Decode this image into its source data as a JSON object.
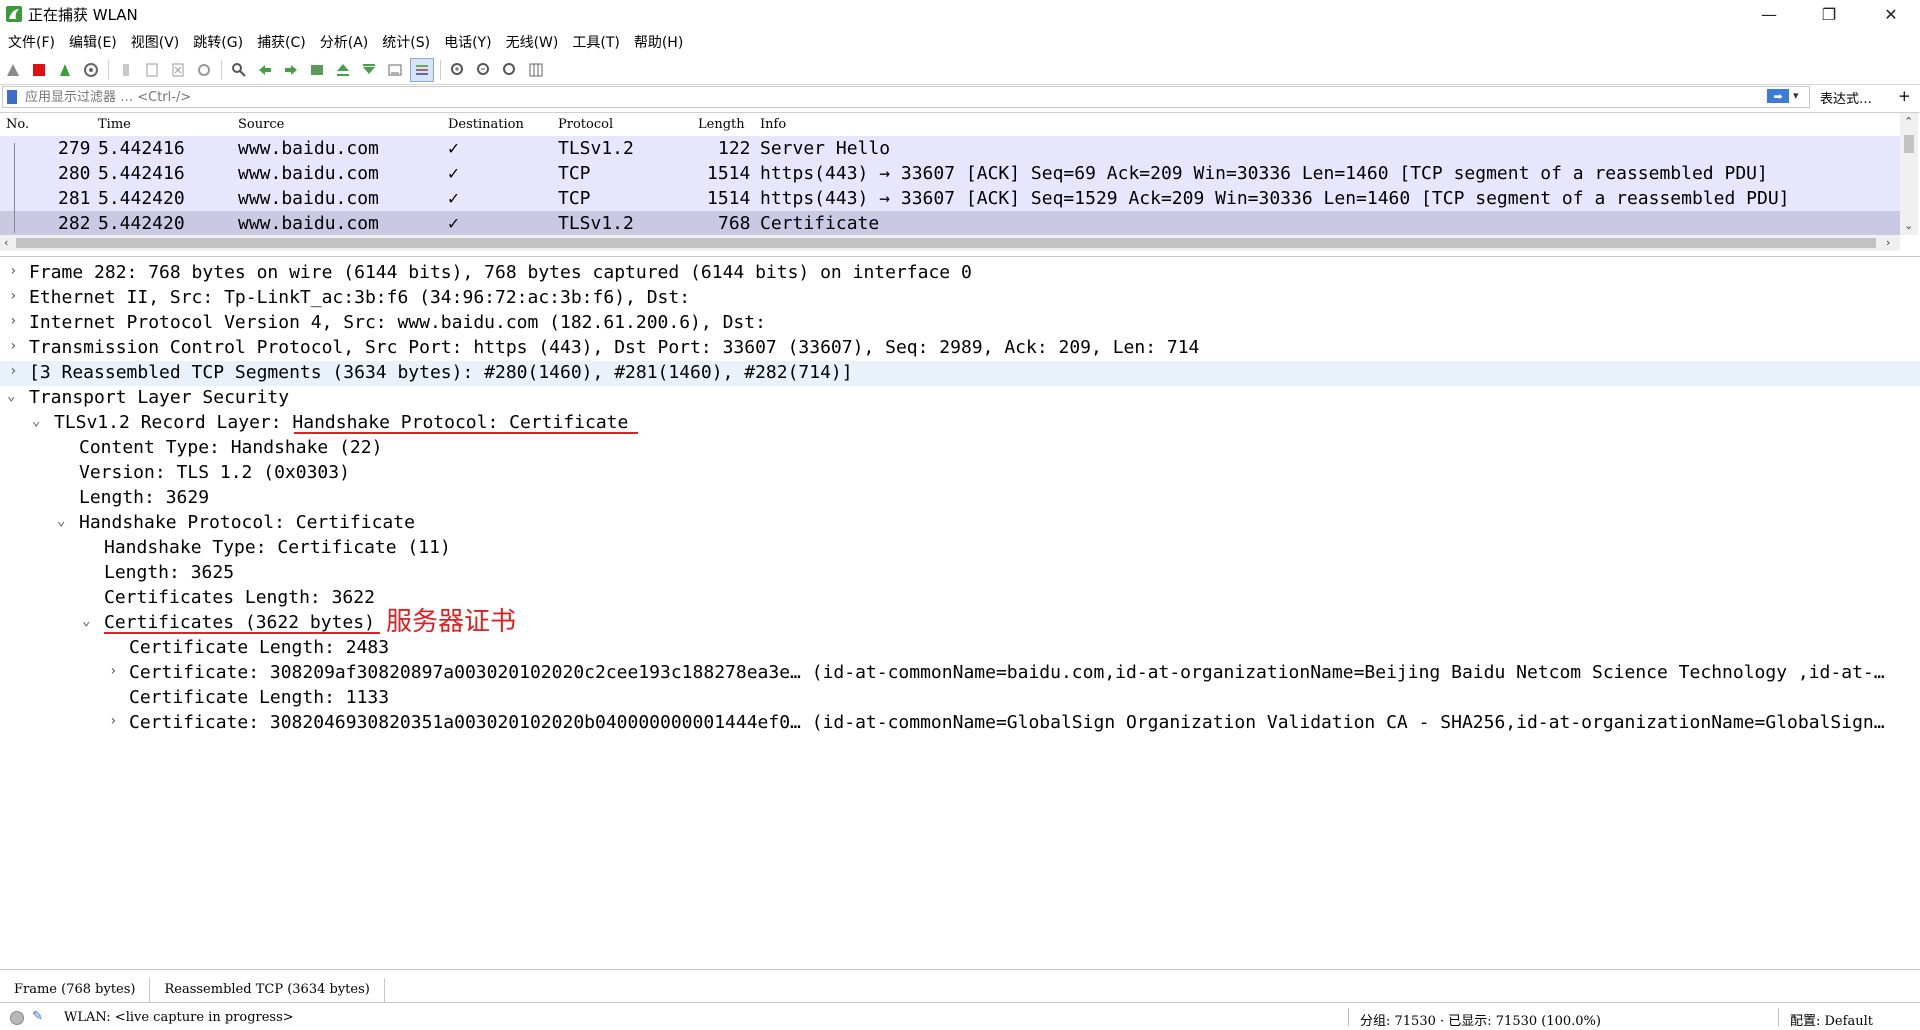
{
  "window": {
    "title": "正在捕获 WLAN",
    "controls": {
      "minimize": "—",
      "maximize": "❐",
      "close": "✕"
    }
  },
  "menu": [
    "文件(F)",
    "编辑(E)",
    "视图(V)",
    "跳转(G)",
    "捕获(C)",
    "分析(A)",
    "统计(S)",
    "电话(Y)",
    "无线(W)",
    "工具(T)",
    "帮助(H)"
  ],
  "filter": {
    "placeholder": "应用显示过滤器 … <Ctrl-/>",
    "apply_icon": "➡",
    "dropdown": "▾",
    "expression_button": "表达式…",
    "add_button": "+"
  },
  "packet_list": {
    "columns": [
      "No.",
      "Time",
      "Source",
      "Destination",
      "Protocol",
      "Length",
      "Info"
    ],
    "rows": [
      {
        "no": "279",
        "time": "5.442416",
        "source": "www.baidu.com",
        "destination": "✓",
        "protocol": "TLSv1.2",
        "length": "122",
        "info": "Server Hello"
      },
      {
        "no": "280",
        "time": "5.442416",
        "source": "www.baidu.com",
        "destination": "✓",
        "protocol": "TCP",
        "length": "1514",
        "info": "https(443) → 33607 [ACK] Seq=69 Ack=209 Win=30336 Len=1460 [TCP segment of a reassembled PDU]"
      },
      {
        "no": "281",
        "time": "5.442420",
        "source": "www.baidu.com",
        "destination": "✓",
        "protocol": "TCP",
        "length": "1514",
        "info": "https(443) → 33607 [ACK] Seq=1529 Ack=209 Win=30336 Len=1460 [TCP segment of a reassembled PDU]"
      },
      {
        "no": "282",
        "time": "5.442420",
        "source": "www.baidu.com",
        "destination": "✓",
        "protocol": "TLSv1.2",
        "length": "768",
        "info": "Certificate"
      }
    ]
  },
  "details": {
    "lines": [
      "Frame 282: 768 bytes on wire (6144 bits), 768 bytes captured (6144 bits) on interface 0",
      "Ethernet II, Src: Tp-LinkT_ac:3b:f6 (34:96:72:ac:3b:f6), Dst:",
      "Internet Protocol Version 4, Src: www.baidu.com (182.61.200.6), Dst:",
      "Transmission Control Protocol, Src Port: https (443), Dst Port: 33607 (33607), Seq: 2989, Ack: 209, Len: 714",
      "[3 Reassembled TCP Segments (3634 bytes): #280(1460), #281(1460), #282(714)]",
      "Transport Layer Security",
      "TLSv1.2 Record Layer: Handshake Protocol: Certificate",
      "Content Type: Handshake (22)",
      "Version: TLS 1.2 (0x0303)",
      "Length: 3629",
      "Handshake Protocol: Certificate",
      "Handshake Type: Certificate (11)",
      "Length: 3625",
      "Certificates Length: 3622",
      "Certificates (3622 bytes)",
      "Certificate Length: 2483",
      "Certificate: 308209af30820897a003020102020c2cee193c188278ea3e… (id-at-commonName=baidu.com,id-at-organizationName=Beijing Baidu Netcom Science Technology ,id-at-…",
      "Certificate Length: 1133",
      "Certificate: 3082046930820351a003020102020b040000000001444ef0… (id-at-commonName=GlobalSign Organization Validation CA - SHA256,id-at-organizationName=GlobalSign…"
    ],
    "annotation": "服务器证书"
  },
  "bytes_tabs": [
    "Frame (768 bytes)",
    "Reassembled TCP (3634 bytes)"
  ],
  "status": {
    "capture": "WLAN: <live capture in progress>",
    "packets": "分组: 71530 · 已显示: 71530 (100.0%)",
    "profile": "配置: Default"
  },
  "colors": {
    "row_bg": "#e7e6ff",
    "row_selected": "#c9c9e4",
    "annotation": "#e02020",
    "highlight": "#e9f2fb"
  }
}
